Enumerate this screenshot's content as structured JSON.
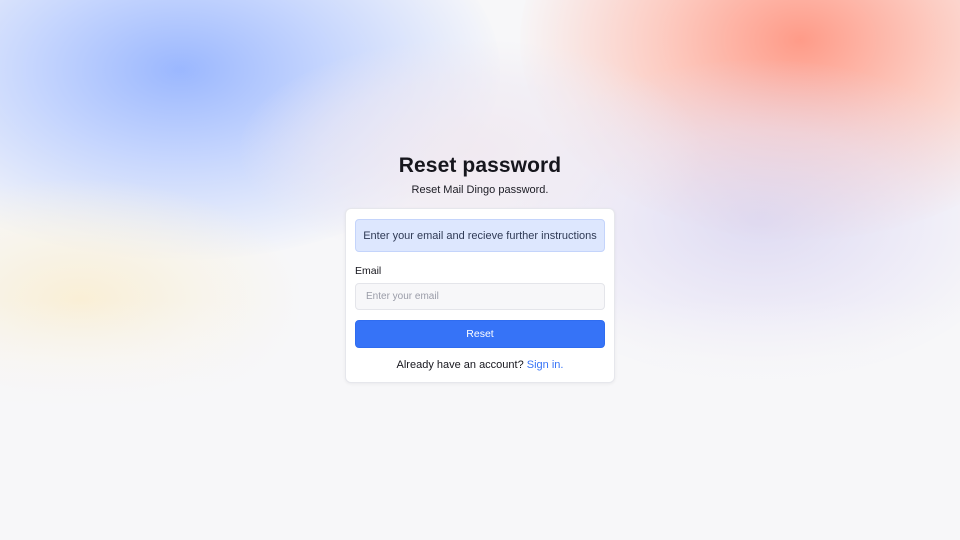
{
  "page": {
    "title": "Reset password",
    "subtitle": "Reset Mail Dingo password."
  },
  "form": {
    "notice": "Enter your email and recieve further instructions",
    "email_label": "Email",
    "email_value": "",
    "email_placeholder": "Enter your email",
    "submit_label": "Reset",
    "footer_text": "Already have an account?",
    "signin_link": "Sign in."
  },
  "colors": {
    "accent": "#3673f7",
    "notice_bg": "#dde7fe",
    "page_bg": "#f7f7f9"
  }
}
